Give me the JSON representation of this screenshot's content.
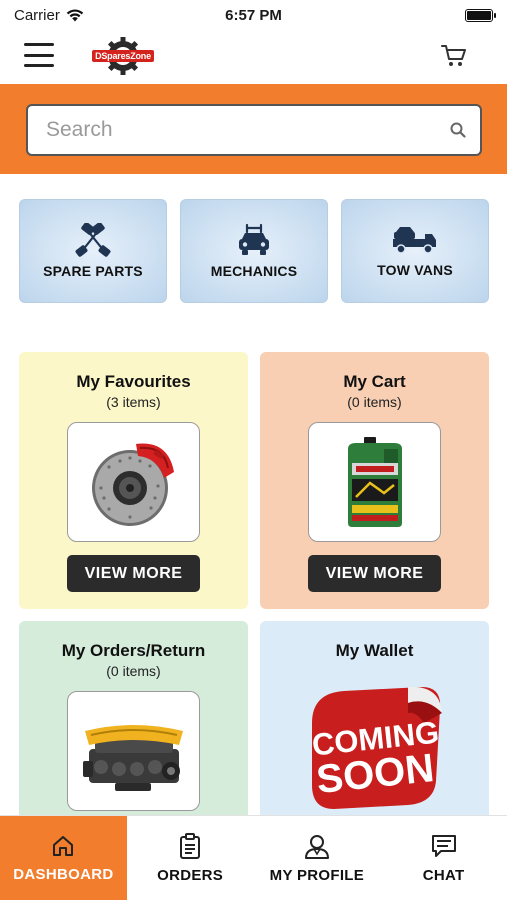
{
  "status_bar": {
    "carrier": "Carrier",
    "time": "6:57 PM"
  },
  "header": {
    "logo_text": "DSparesZone",
    "menu_icon": "hamburger-menu-icon",
    "cart_icon": "cart-icon"
  },
  "search": {
    "placeholder": "Search",
    "value": ""
  },
  "categories": [
    {
      "label": "SPARE PARTS",
      "icon": "pistons-icon"
    },
    {
      "label": "MECHANICS",
      "icon": "car-service-icon"
    },
    {
      "label": "TOW VANS",
      "icon": "tow-truck-icon"
    }
  ],
  "tiles": {
    "favourites": {
      "title": "My Favourites",
      "count": "(3 items)",
      "button": "VIEW MORE"
    },
    "cart": {
      "title": "My Cart",
      "count": "(0 items)",
      "button": "VIEW MORE"
    },
    "orders": {
      "title": "My Orders/Return",
      "count": "(0 items)"
    },
    "wallet": {
      "title": "My Wallet",
      "badge_line1": "COMING",
      "badge_line2": "SOON"
    }
  },
  "bottom_nav": [
    {
      "label": "DASHBOARD",
      "icon": "home-icon",
      "active": true
    },
    {
      "label": "ORDERS",
      "icon": "clipboard-icon",
      "active": false
    },
    {
      "label": "MY PROFILE",
      "icon": "user-icon",
      "active": false
    },
    {
      "label": "CHAT",
      "icon": "chat-icon",
      "active": false
    }
  ],
  "colors": {
    "accent": "#f27d2c",
    "dark_button": "#2b2b2b",
    "fav_bg": "#fbf7c8",
    "cart_bg": "#f9cfb3",
    "orders_bg": "#d5ecdb",
    "wallet_bg": "#dcebf8"
  }
}
